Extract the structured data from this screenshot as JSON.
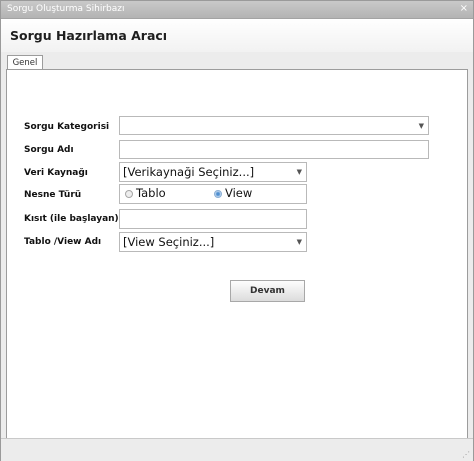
{
  "window": {
    "title": "Sorgu Oluşturma Sihirbazı",
    "close_glyph": "×"
  },
  "header": {
    "title": "Sorgu Hazırlama Aracı"
  },
  "tabs": [
    {
      "label": "Genel"
    }
  ],
  "form": {
    "category": {
      "label": "Sorgu Kategorisi",
      "value": ""
    },
    "name": {
      "label": "Sorgu Adı",
      "value": ""
    },
    "datasource": {
      "label": "Veri Kaynağı",
      "value": "[Verikaynaği Seçiniz...]"
    },
    "object_type": {
      "label": "Nesne Türü",
      "options": [
        "Tablo",
        "View"
      ],
      "selected": "View"
    },
    "constraint": {
      "label": "Kısıt (ile başlayan)",
      "value": ""
    },
    "table_view": {
      "label": "Tablo /View Adı",
      "value": "[View Seçiniz...]"
    }
  },
  "buttons": {
    "continue": "Devam"
  },
  "icons": {
    "close": "close-icon",
    "dropdown": "chevron-down-icon",
    "resize": "resize-grip-icon"
  }
}
